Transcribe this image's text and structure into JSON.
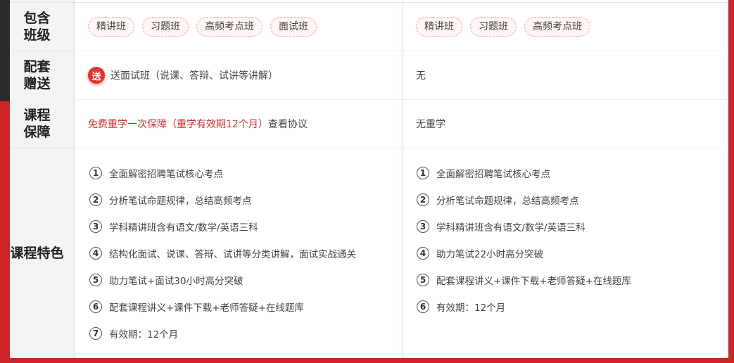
{
  "rows": {
    "classes": {
      "header": "包含\n班级",
      "col1_tags": [
        "精讲班",
        "习题班",
        "高频考点班",
        "面试班"
      ],
      "col2_tags": [
        "精讲班",
        "习题班",
        "高频考点班"
      ]
    },
    "gift": {
      "header": "配套\n赠送",
      "badge": "送",
      "col1_text": "送面试班（说课、答辩、试讲等讲解）",
      "col2_text": "无"
    },
    "guarantee": {
      "header": "课程\n保障",
      "col1_red": "免费重学一次保障（重学有效期12个月）",
      "col1_link": "查看协议",
      "col2_text": "无重学"
    },
    "features": {
      "header": "课程特色",
      "col1_items": [
        {
          "num": "1",
          "text": "全面解密招聘笔试核心考点"
        },
        {
          "num": "2",
          "text": "分析笔试命题规律，总结高频考点"
        },
        {
          "num": "3",
          "text": "学科精讲班含有语文/数学/英语三科"
        },
        {
          "num": "4",
          "text": "结构化面试、说课、答辩、试讲等分类讲解，面试实战通关"
        },
        {
          "num": "5",
          "text": "助力笔试+面试30小时高分突破"
        },
        {
          "num": "6",
          "text": "配套课程讲义+课件下载+老师答疑+在线题库"
        },
        {
          "num": "7",
          "text": "有效期：12个月"
        }
      ],
      "col2_items": [
        {
          "num": "1",
          "text": "全面解密招聘笔试核心考点"
        },
        {
          "num": "2",
          "text": "分析笔试命题规律，总结高频考点"
        },
        {
          "num": "3",
          "text": "学科精讲班含有语文/数学/英语三科"
        },
        {
          "num": "4",
          "text": "助力笔试22小时高分突破"
        },
        {
          "num": "5",
          "text": "配套课程讲义+课件下载+老师答疑+在线题库"
        },
        {
          "num": "6",
          "text": "有效期：12个月"
        }
      ]
    }
  },
  "colors": {
    "accent": "#cc2525",
    "dark": "#2a2a2a",
    "tag_border": "#f0a8a8"
  }
}
